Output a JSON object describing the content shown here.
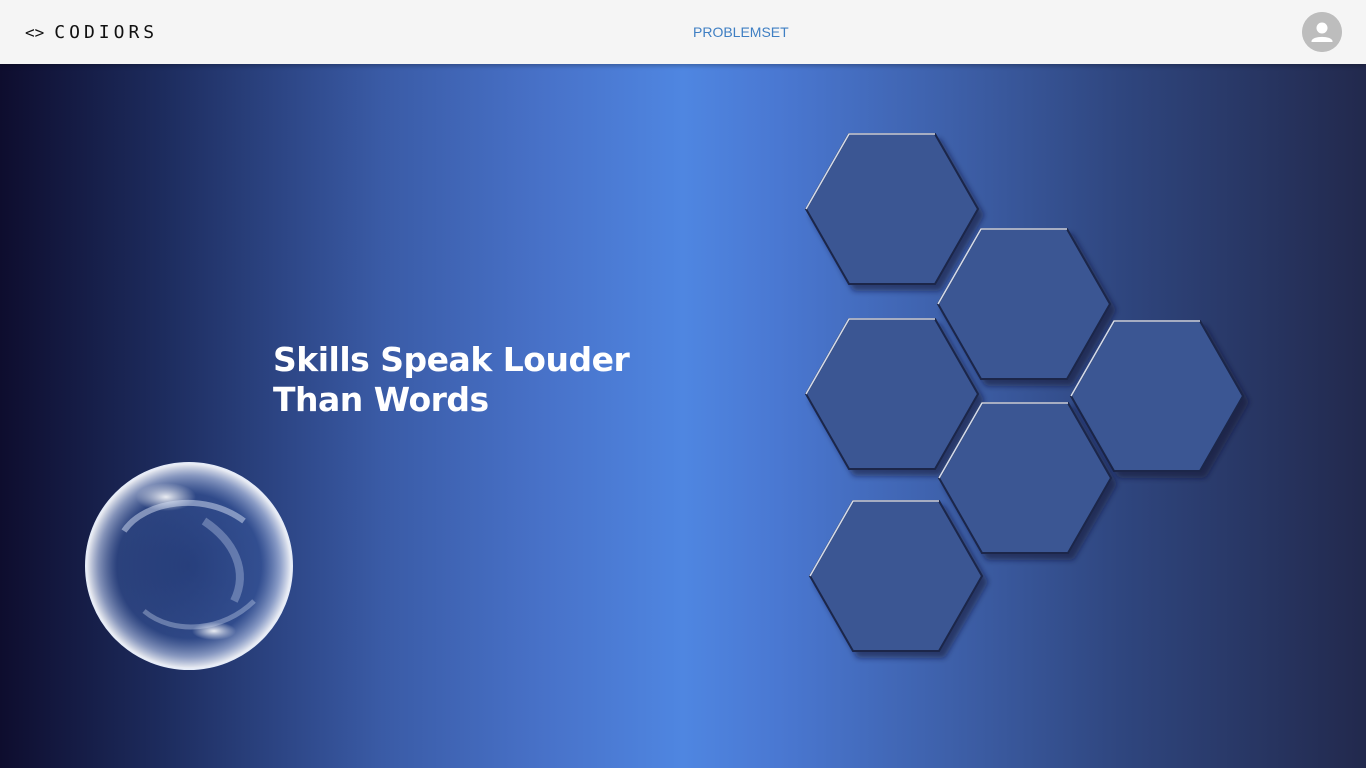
{
  "navbar": {
    "brand_icon": "<>",
    "brand_name": "CODIORS",
    "links": [
      {
        "label": "PROBLEMSET"
      }
    ],
    "avatar_icon": "account-circle-icon"
  },
  "hero": {
    "headline_line1": "Skills Speak Louder",
    "headline_line2": "Than Words"
  },
  "colors": {
    "navbar_bg": "#f5f5f5",
    "link": "#3f7fc3",
    "hero_center": "#4f86e1",
    "hero_edge": "#0e0d2e",
    "hexagon_fill": "#3a5693"
  }
}
